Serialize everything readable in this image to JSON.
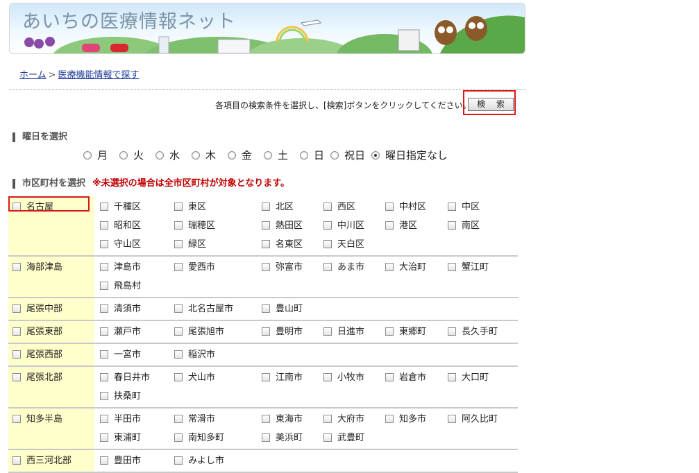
{
  "header": {
    "site_title": "あいちの医療情報ネット"
  },
  "breadcrumb": {
    "home": "ホーム",
    "separator": ">",
    "current": "医療機能情報で探す"
  },
  "search": {
    "instruction": "各項目の検索条件を選択し、[検索]ボタンをクリックしてください。→",
    "button_label": "検 索"
  },
  "weekday": {
    "heading": "曜日を選択",
    "options": [
      {
        "label": "月",
        "selected": false
      },
      {
        "label": "火",
        "selected": false
      },
      {
        "label": "水",
        "selected": false
      },
      {
        "label": "木",
        "selected": false
      },
      {
        "label": "金",
        "selected": false
      },
      {
        "label": "土",
        "selected": false
      },
      {
        "label": "日",
        "selected": false
      },
      {
        "label": "祝日",
        "selected": false
      },
      {
        "label": "曜日指定なし",
        "selected": true
      }
    ]
  },
  "municipality": {
    "heading": "市区町村を選択",
    "note": "※未選択の場合は全市区町村が対象となります。",
    "regions": [
      {
        "name": "名古屋",
        "cities": [
          "千種区",
          "東区",
          "北区",
          "西区",
          "中村区",
          "中区",
          "昭和区",
          "瑞穂区",
          "熱田区",
          "中川区",
          "港区",
          "南区",
          "守山区",
          "緑区",
          "名東区",
          "天白区"
        ]
      },
      {
        "name": "海部津島",
        "cities": [
          "津島市",
          "愛西市",
          "弥富市",
          "あま市",
          "大治町",
          "蟹江町",
          "飛島村"
        ]
      },
      {
        "name": "尾張中部",
        "cities": [
          "清須市",
          "北名古屋市",
          "豊山町"
        ]
      },
      {
        "name": "尾張東部",
        "cities": [
          "瀬戸市",
          "尾張旭市",
          "豊明市",
          "日進市",
          "東郷町",
          "長久手町"
        ]
      },
      {
        "name": "尾張西部",
        "cities": [
          "一宮市",
          "稲沢市"
        ]
      },
      {
        "name": "尾張北部",
        "cities": [
          "春日井市",
          "犬山市",
          "江南市",
          "小牧市",
          "岩倉市",
          "大口町",
          "扶桑町"
        ]
      },
      {
        "name": "知多半島",
        "cities": [
          "半田市",
          "常滑市",
          "東海市",
          "大府市",
          "知多市",
          "阿久比町",
          "東浦町",
          "南知多町",
          "美浜町",
          "武豊町"
        ]
      },
      {
        "name": "西三河北部",
        "cities": [
          "豊田市",
          "みよし市"
        ]
      }
    ]
  }
}
